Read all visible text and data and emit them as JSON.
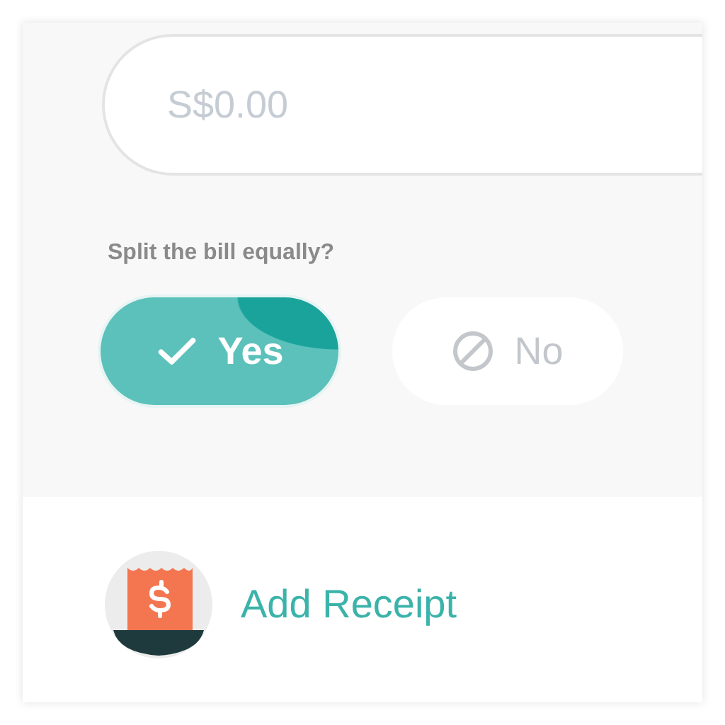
{
  "amount_field": {
    "placeholder": "S$0.00"
  },
  "split_question": "Split the bill equally?",
  "options": [
    {
      "label": "Yes",
      "kind": "yes",
      "selected": true
    },
    {
      "label": "No",
      "kind": "no",
      "selected": false
    }
  ],
  "add_receipt": {
    "label": "Add Receipt"
  }
}
